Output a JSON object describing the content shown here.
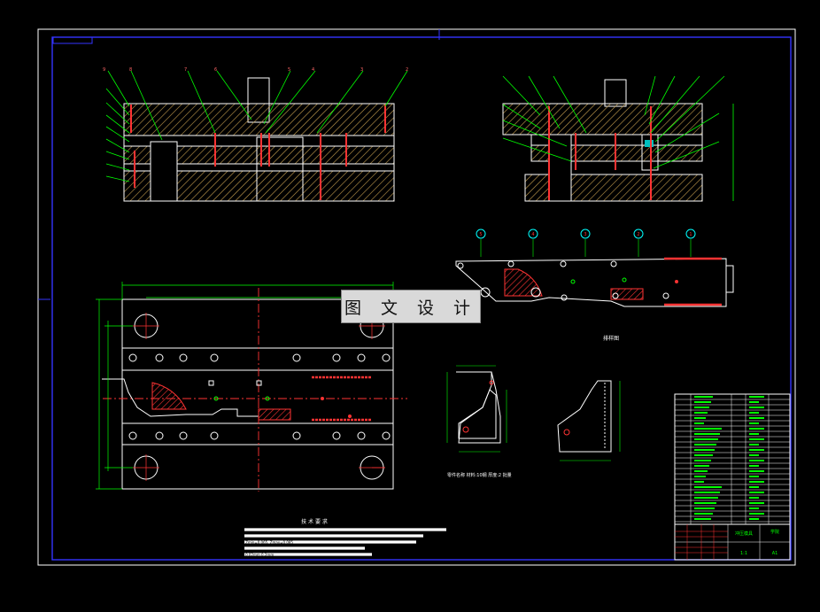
{
  "watermark": "图 文 设 计",
  "tech_requirements": {
    "title": "技 术 要 求",
    "lines": [
      "1.",
      "2.",
      "3.                         Zmin=0.065, Zmax=0.085",
      "4.",
      "5.                           0.02mm      0.2mm"
    ]
  },
  "strip_layout": {
    "title": "排样图",
    "station_markers": [
      "5",
      "4",
      "3",
      "2",
      "1"
    ]
  },
  "part_caption": "零件名称  材料:10钢  厚度:2  批量",
  "title_block": {
    "drawing_name": "冲压模具",
    "scale": "1:1",
    "sheet": "A1",
    "company": "学院"
  },
  "colors": {
    "frame": "#ffffff",
    "inner_border": "#3333ff",
    "leader": "#00ff00",
    "hatch": "#cc9933",
    "center_line": "#ff0000",
    "balloon": "#00ffff",
    "dimension": "#00ff00"
  }
}
